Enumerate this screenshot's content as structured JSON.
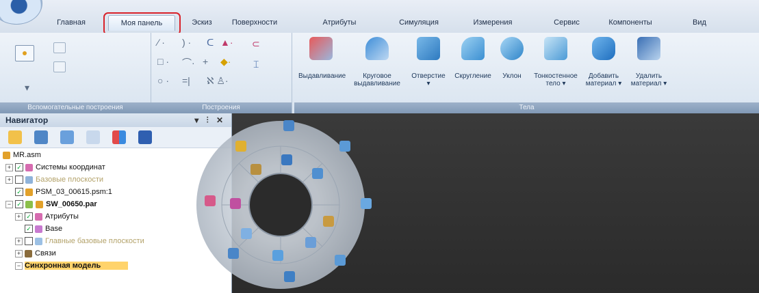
{
  "tabs": [
    {
      "label": "Главная"
    },
    {
      "label": "Моя панель"
    },
    {
      "label": "Эскиз"
    },
    {
      "label": "Поверхности"
    },
    {
      "label": "Атрибуты"
    },
    {
      "label": "Симуляция"
    },
    {
      "label": "Измерения"
    },
    {
      "label": "Сервис"
    },
    {
      "label": "Компоненты"
    },
    {
      "label": "Вид"
    }
  ],
  "ribbon": {
    "groups": [
      {
        "label": "Вспомогательные построения"
      },
      {
        "label": "Построения"
      },
      {
        "label": "Тела"
      }
    ],
    "tela_buttons": [
      {
        "label_line1": "Выдавливание",
        "label_line2": ""
      },
      {
        "label_line1": "Круговое",
        "label_line2": "выдавливание"
      },
      {
        "label_line1": "Отверстие",
        "label_line2": "▾"
      },
      {
        "label_line1": "Скругление",
        "label_line2": ""
      },
      {
        "label_line1": "Уклон",
        "label_line2": ""
      },
      {
        "label_line1": "Тонкостенное",
        "label_line2": "тело ▾"
      },
      {
        "label_line1": "Добавить",
        "label_line2": "материал ▾"
      },
      {
        "label_line1": "Удалить",
        "label_line2": "материал ▾"
      }
    ]
  },
  "navigator": {
    "title": "Навигатор",
    "controls": "▾ ⫶ ✕",
    "tree": [
      {
        "text": "MR.asm"
      },
      {
        "text": "Системы координат"
      },
      {
        "text": "Базовые плоскости"
      },
      {
        "text": "PSM_03_00615.psm:1"
      },
      {
        "text": "SW_00650.par"
      },
      {
        "text": "Атрибуты"
      },
      {
        "text": "Base"
      },
      {
        "text": "Главные базовые плоскости"
      },
      {
        "text": "Связи"
      },
      {
        "text": "Синхронная модель"
      }
    ]
  },
  "colors": {
    "accent_red": "#d8222a",
    "ribbon_group_label": "#8199b6",
    "viewport": "#2f2f2f",
    "selection": "#ffd36b"
  }
}
